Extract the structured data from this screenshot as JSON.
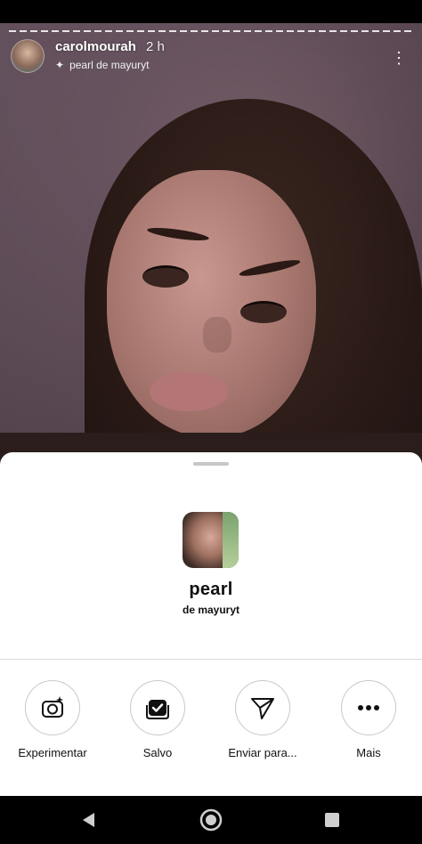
{
  "story": {
    "username": "carolmourah",
    "time": "2 h",
    "filter_label": "pearl de mayuryt"
  },
  "sheet": {
    "effect_name": "pearl",
    "effect_author": "de mayuryt",
    "actions": [
      {
        "label": "Experimentar",
        "icon": "camera-sparkle-icon"
      },
      {
        "label": "Salvo",
        "icon": "saved-effects-icon"
      },
      {
        "label": "Enviar para...",
        "icon": "send-icon"
      },
      {
        "label": "Mais",
        "icon": "more-horizontal-icon"
      }
    ]
  },
  "nav": {
    "icons": [
      "back-icon",
      "home-icon",
      "recents-icon"
    ]
  },
  "colors": {
    "sheet_bg": "#ffffff",
    "text": "#111111",
    "divider": "#dbdbdb"
  }
}
